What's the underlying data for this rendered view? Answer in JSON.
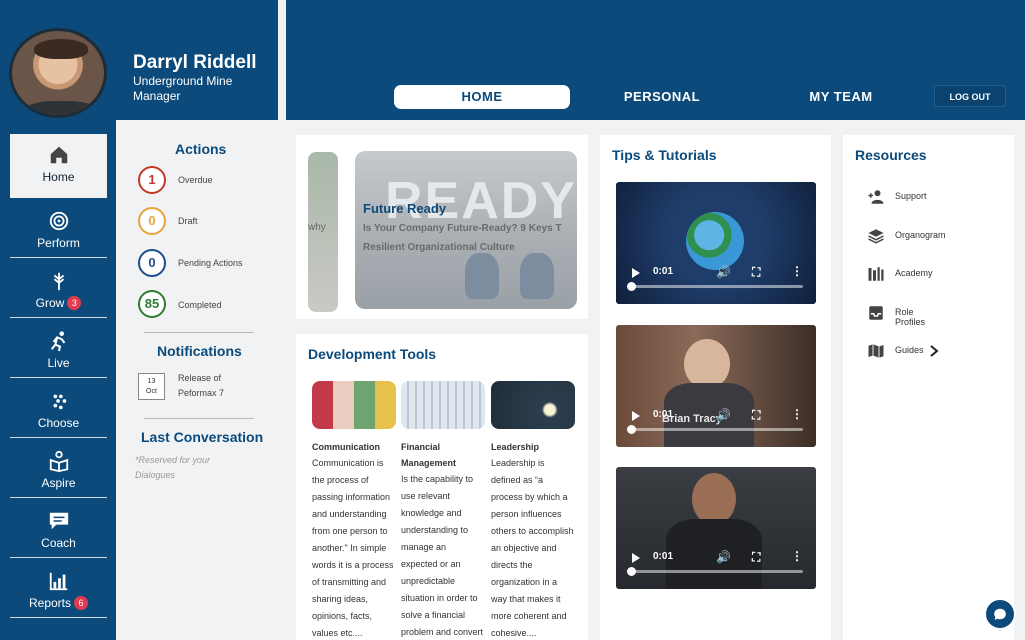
{
  "profile": {
    "name": "Darryl Riddell",
    "role": "Underground Mine Manager"
  },
  "nav": [
    {
      "label": "Home",
      "icon": "home-icon",
      "badge": null
    },
    {
      "label": "Perform",
      "icon": "target-icon",
      "badge": null
    },
    {
      "label": "Grow",
      "icon": "wheat-icon",
      "badge": "3"
    },
    {
      "label": "Live",
      "icon": "runner-icon",
      "badge": null
    },
    {
      "label": "Choose",
      "icon": "dots-icon",
      "badge": null
    },
    {
      "label": "Aspire",
      "icon": "reader-icon",
      "badge": null
    },
    {
      "label": "Coach",
      "icon": "chat-bubble-icon",
      "badge": null
    },
    {
      "label": "Reports",
      "icon": "bar-chart-icon",
      "badge": "6"
    }
  ],
  "actions": {
    "title": "Actions",
    "items": [
      {
        "count": "1",
        "label": "Overdue",
        "color": "#c0392b"
      },
      {
        "count": "0",
        "label": "Draft",
        "color": "#e8a33d"
      },
      {
        "count": "0",
        "label": "Pending Actions",
        "color": "#1f4e8c"
      },
      {
        "count": "85",
        "label": "Completed",
        "color": "#2e7d32"
      }
    ]
  },
  "notifications": {
    "title": "Notifications",
    "day": "13",
    "month": "Oct",
    "text": "Release of Peformax 7"
  },
  "last_conversation": {
    "title": "Last Conversation",
    "note": "*Reserved for your Dialogues"
  },
  "topbar": {
    "tabs": [
      "HOME",
      "PERSONAL",
      "MY TEAM"
    ],
    "logout": "LOG OUT"
  },
  "banner": {
    "prev_fragment": "why",
    "image_word": "READY",
    "title": "Future Ready",
    "subtitle": "Is Your Company Future-Ready? 9 Keys T Resilient Organizational Culture"
  },
  "dev_tools": {
    "title": "Development Tools",
    "items": [
      {
        "name": "Communication",
        "desc": "Communication is the process of passing information and understanding from one person to another.\" In simple words it is a process of transmitting and sharing ideas, opinions, facts, values etc...."
      },
      {
        "name": "Financial Management",
        "desc": "Is the capability to use relevant knowledge and understanding to manage an expected or an unpredictable situation in order to solve a financial problem and convert it to a"
      },
      {
        "name": "Leadership",
        "desc": "Leadership is defined as “a process by which a person influences others to accomplish an objective and directs the organization in a way that makes it more coherent and cohesive...."
      }
    ]
  },
  "tips": {
    "title": "Tips & Tutorials",
    "videos": [
      {
        "time": "0:01",
        "caption": ""
      },
      {
        "time": "0:01",
        "caption": "Brian Tracy"
      },
      {
        "time": "0:01",
        "caption": ""
      }
    ]
  },
  "resources": {
    "title": "Resources",
    "items": [
      {
        "label": "Support",
        "icon": "person-add-icon"
      },
      {
        "label": "Organogram",
        "icon": "layers-icon"
      },
      {
        "label": "Academy",
        "icon": "books-icon"
      },
      {
        "label": "Role Profiles",
        "icon": "inbox-icon"
      },
      {
        "label": "Guides",
        "icon": "map-icon"
      }
    ]
  }
}
